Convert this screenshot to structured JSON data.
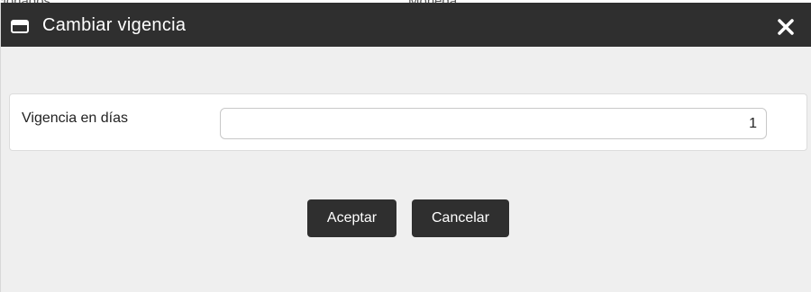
{
  "backdrop": {
    "left_text": "cionados",
    "right_text": "Moneda"
  },
  "dialog": {
    "title": "Cambiar vigencia",
    "title_icon": "window-icon",
    "close_icon": "close-icon"
  },
  "form": {
    "label": "Vigencia en días",
    "value": "1"
  },
  "buttons": {
    "accept_label": "Aceptar",
    "cancel_label": "Cancelar"
  },
  "colors": {
    "titlebar": "#2f2f2f",
    "dialog_bg": "#efefef",
    "button_bg": "#2f2f2f",
    "button_text": "#ffffff"
  }
}
